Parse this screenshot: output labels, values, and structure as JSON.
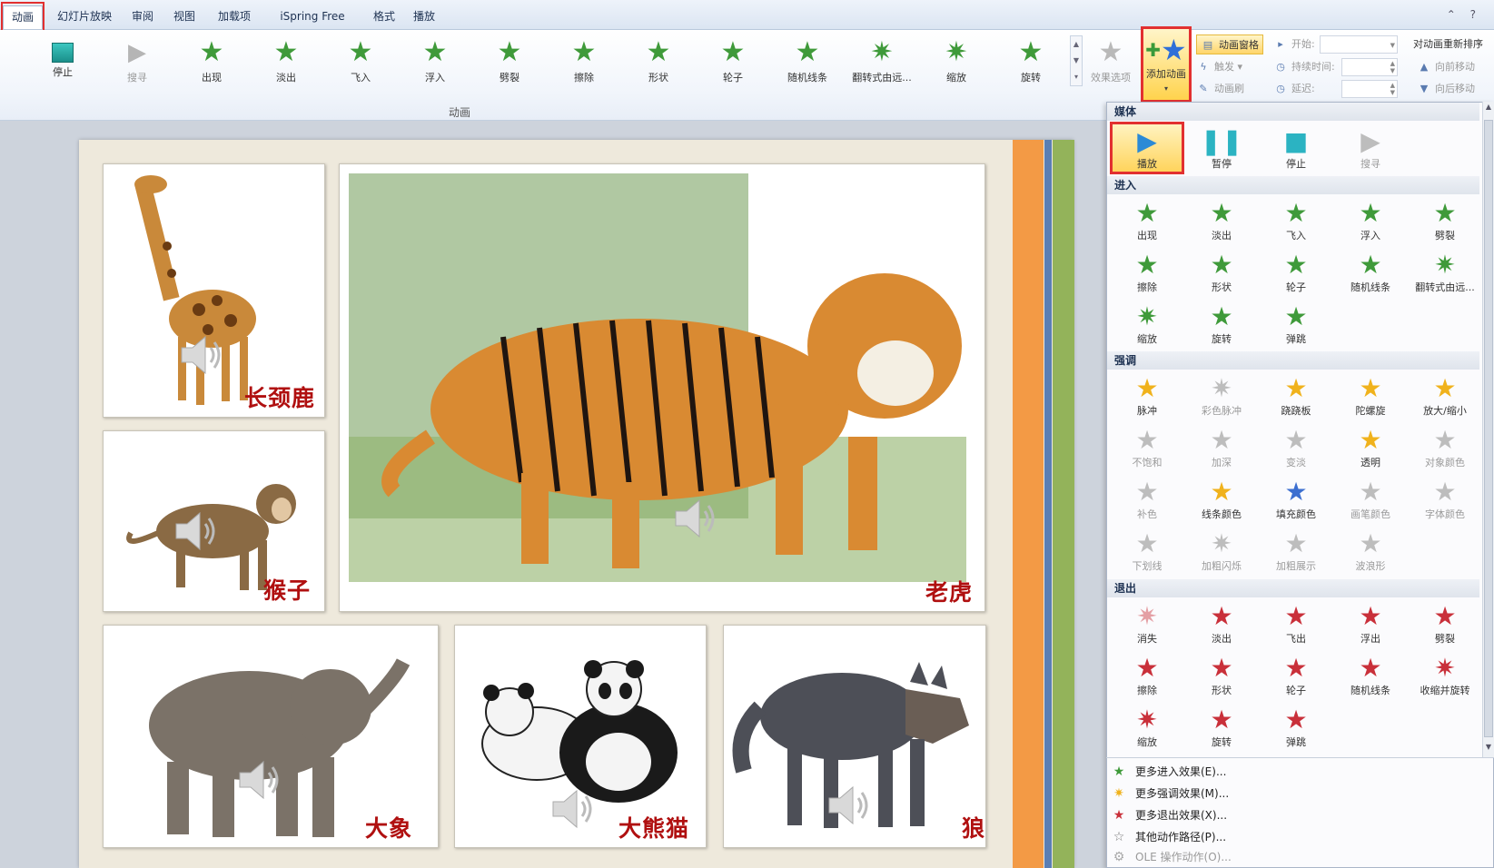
{
  "tabs": [
    "动画",
    "幻灯片放映",
    "审阅",
    "视图",
    "加载项",
    "iSpring Free",
    "格式",
    "播放"
  ],
  "ribbon": {
    "group_label": "动画",
    "buttons": [
      "停止",
      "搜寻",
      "出现",
      "淡出",
      "飞入",
      "浮入",
      "劈裂",
      "擦除",
      "形状",
      "轮子",
      "随机线条",
      "翻转式由远...",
      "缩放",
      "旋转"
    ],
    "effect_options": "效果选项",
    "add_animation": "添加动画",
    "animation_pane": "动画窗格",
    "trigger": "触发",
    "animation_painter": "动画刷",
    "start_label": "开始:",
    "duration_label": "持续时间:",
    "delay_label": "延迟:",
    "reorder_title": "对动画重新排序",
    "move_earlier": "向前移动",
    "move_later": "向后移动"
  },
  "gallery": {
    "media_title": "媒体",
    "media": [
      "播放",
      "暂停",
      "停止",
      "搜寻"
    ],
    "entrance_title": "进入",
    "entrance": [
      "出现",
      "淡出",
      "飞入",
      "浮入",
      "劈裂",
      "擦除",
      "形状",
      "轮子",
      "随机线条",
      "翻转式由远...",
      "缩放",
      "旋转",
      "弹跳"
    ],
    "emphasis_title": "强调",
    "emphasis": [
      "脉冲",
      "彩色脉冲",
      "跷跷板",
      "陀螺旋",
      "放大/缩小",
      "不饱和",
      "加深",
      "变淡",
      "透明",
      "对象颜色",
      "补色",
      "线条颜色",
      "填充颜色",
      "画笔颜色",
      "字体颜色",
      "下划线",
      "加粗闪烁",
      "加粗展示",
      "波浪形"
    ],
    "exit_title": "退出",
    "exit": [
      "消失",
      "淡出",
      "飞出",
      "浮出",
      "劈裂",
      "擦除",
      "形状",
      "轮子",
      "随机线条",
      "收缩并旋转",
      "缩放",
      "旋转",
      "弹跳"
    ],
    "more": [
      "更多进入效果(E)...",
      "更多强调效果(M)...",
      "更多退出效果(X)...",
      "其他动作路径(P)...",
      "OLE 操作动作(O)..."
    ]
  },
  "slide": {
    "animals": [
      "长颈鹿",
      "猴子",
      "老虎",
      "大象",
      "大熊猫",
      "狼"
    ]
  },
  "colors": {
    "accent_red": "#e23030",
    "stripe_orange": "#f39a45",
    "stripe_blue": "#5b7fb4",
    "stripe_green": "#93b35a",
    "animal_label": "#b01010"
  }
}
